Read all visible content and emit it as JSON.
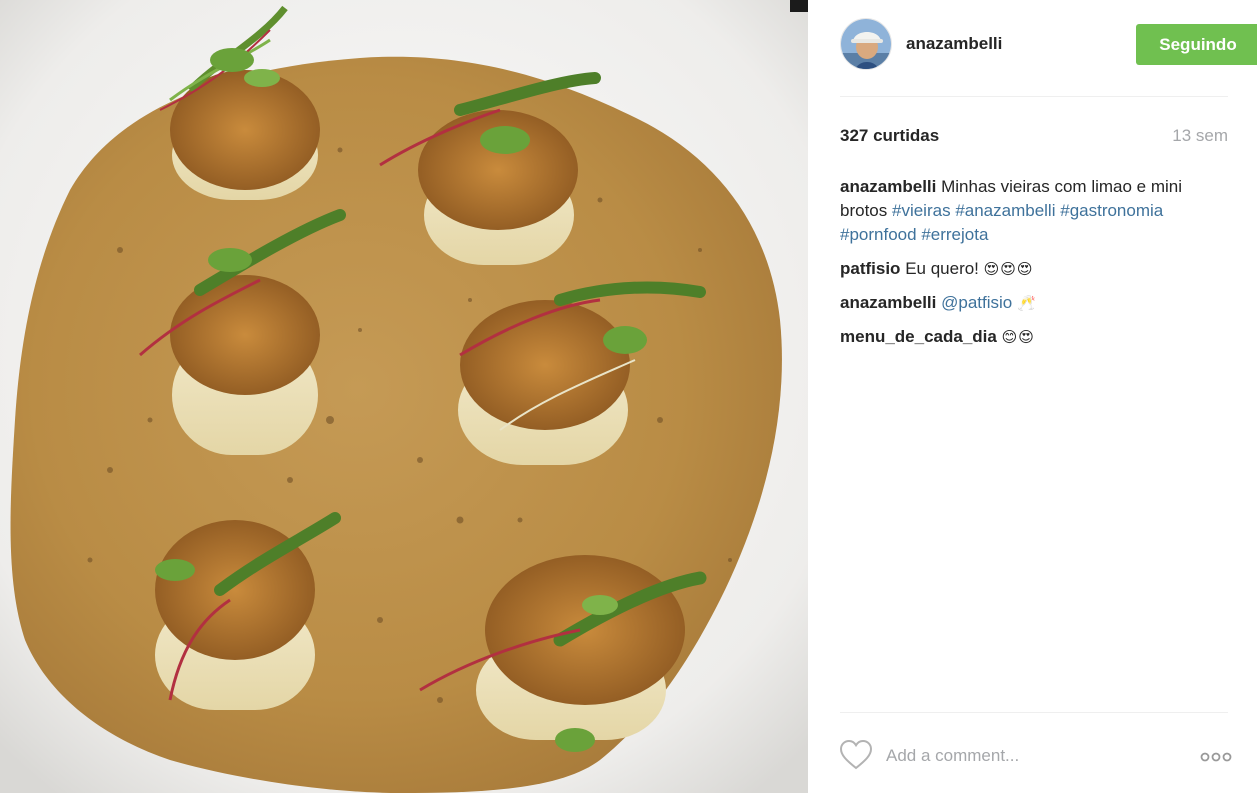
{
  "post": {
    "image_alt": "Vieiras com limao e mini brotos",
    "colors": {
      "follow_button": "#70c050",
      "hashtag": "#3f729b",
      "muted": "#a5a7aa"
    }
  },
  "header": {
    "username": "anazambelli",
    "follow_label": "Seguindo",
    "avatar_icon": "user-avatar"
  },
  "stats": {
    "likes": "327 curtidas",
    "time_ago": "13 sem"
  },
  "caption": {
    "author": "anazambelli",
    "text": "Minhas vieiras com limao e mini brotos",
    "hashtags": [
      "#vieiras",
      "#anazambelli",
      "#gastronomia",
      "#pornfood",
      "#errejota"
    ]
  },
  "comments": [
    {
      "author": "patfisio",
      "text": "Eu quero!",
      "emoji": "😍😍😍"
    },
    {
      "author": "anazambelli",
      "mention": "@patfisio",
      "emoji": "🥂"
    },
    {
      "author": "menu_de_cada_dia",
      "emoji": "😊😍"
    }
  ],
  "footer": {
    "comment_placeholder": "Add a comment...",
    "like_icon": "heart-icon",
    "more_icon": "more-options-icon"
  }
}
